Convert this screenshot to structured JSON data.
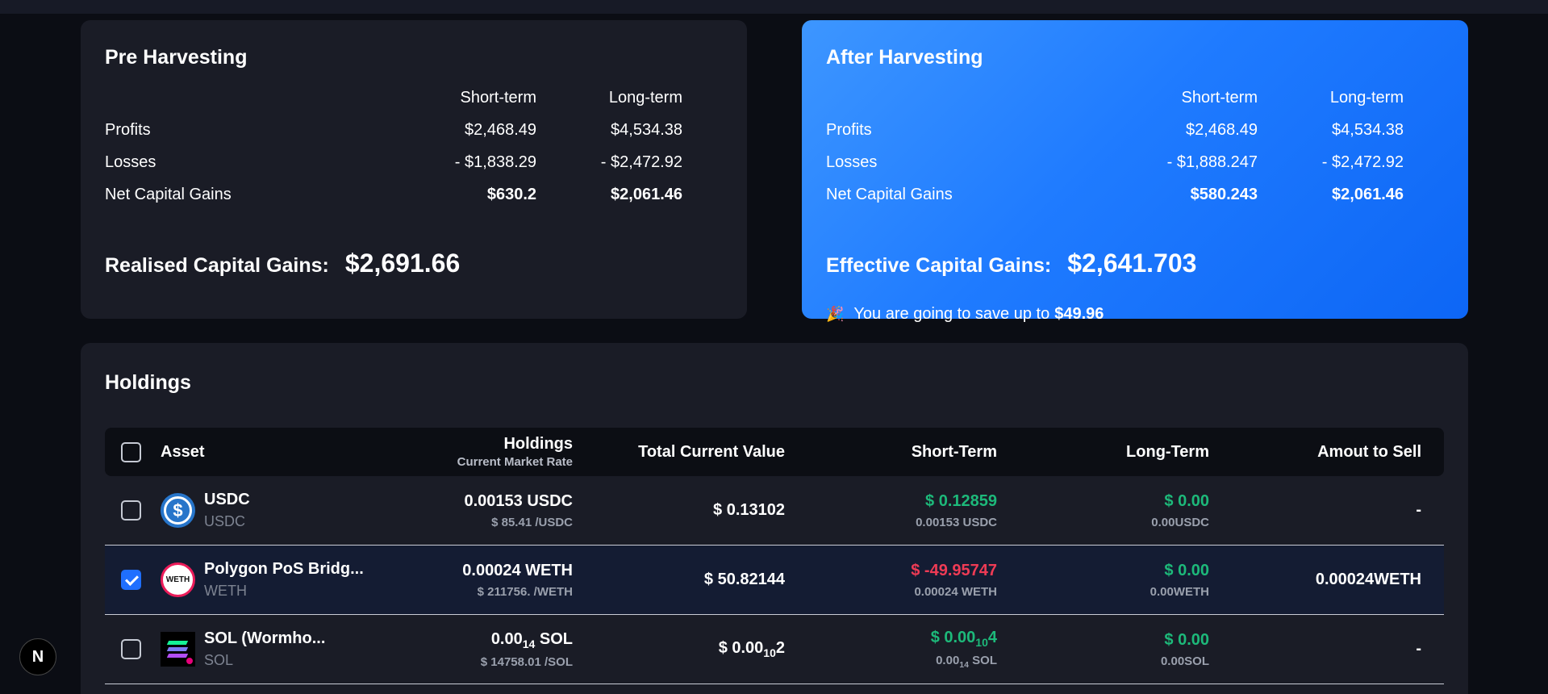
{
  "pre": {
    "title": "Pre Harvesting",
    "col_short": "Short-term",
    "col_long": "Long-term",
    "rows": [
      {
        "label": "Profits",
        "short": "$2,468.49",
        "long": "$4,534.38"
      },
      {
        "label": "Losses",
        "short": "- $1,838.29",
        "long": "- $2,472.92"
      },
      {
        "label": "Net Capital Gains",
        "short": "$630.2",
        "long": "$2,061.46"
      }
    ],
    "total_label": "Realised Capital Gains:",
    "total_value": "$2,691.66"
  },
  "after": {
    "title": "After Harvesting",
    "col_short": "Short-term",
    "col_long": "Long-term",
    "rows": [
      {
        "label": "Profits",
        "short": "$2,468.49",
        "long": "$4,534.38"
      },
      {
        "label": "Losses",
        "short": "- $1,888.247",
        "long": "- $2,472.92"
      },
      {
        "label": "Net Capital Gains",
        "short": "$580.243",
        "long": "$2,061.46"
      }
    ],
    "total_label": "Effective Capital Gains:",
    "total_value": "$2,641.703",
    "save_emoji": "🎉",
    "save_text": "You are going to save up to",
    "save_amount": "$49.96"
  },
  "holdings": {
    "title": "Holdings",
    "headers": {
      "asset": "Asset",
      "holdings": "Holdings",
      "holdings_sub": "Current Market Rate",
      "total_value": "Total Current Value",
      "short_term": "Short-Term",
      "long_term": "Long-Term",
      "amount_to_sell": "Amout to Sell"
    },
    "rows": [
      {
        "name": "USDC",
        "symbol": "USDC",
        "checked": false,
        "holding": "0.00153 USDC",
        "rate": "$ 85.41 /USDC",
        "total": "$ 0.13102",
        "st_value": "$ 0.12859",
        "st_sub": "0.00153 USDC",
        "lt_value": "$ 0.00",
        "lt_sub": "0.00USDC",
        "sell": "-"
      },
      {
        "name": "Polygon PoS Bridg...",
        "symbol": "WETH",
        "checked": true,
        "holding": "0.00024 WETH",
        "rate": "$ 211756. /WETH",
        "total": "$ 50.82144",
        "st_value": "$ -49.95747",
        "st_sub": "0.00024 WETH",
        "lt_value": "$ 0.00",
        "lt_sub": "0.00WETH",
        "sell": "0.00024WETH"
      },
      {
        "name": "SOL (Wormho...",
        "symbol": "SOL",
        "checked": false,
        "holding_pre": "0.00",
        "holding_zeros": "14",
        "holding_post": " SOL",
        "rate": "$ 14758.01 /SOL",
        "total_pre": "$ 0.00",
        "total_zeros": "10",
        "total_post": "2",
        "st_pre": "$ 0.00",
        "st_zeros": "10",
        "st_post": "4",
        "st_sub_pre": "0.00",
        "st_sub_zeros": "14",
        "st_sub_post": " SOL",
        "lt_value": "$ 0.00",
        "lt_sub": "0.00SOL",
        "sell": "-"
      }
    ]
  },
  "dev_badge": "N",
  "colors": {
    "background": "#0b0d14",
    "card": "#1a1c26",
    "accent_blue": "#1f7bff",
    "positive": "#1db97a",
    "negative": "#ef3b55"
  }
}
